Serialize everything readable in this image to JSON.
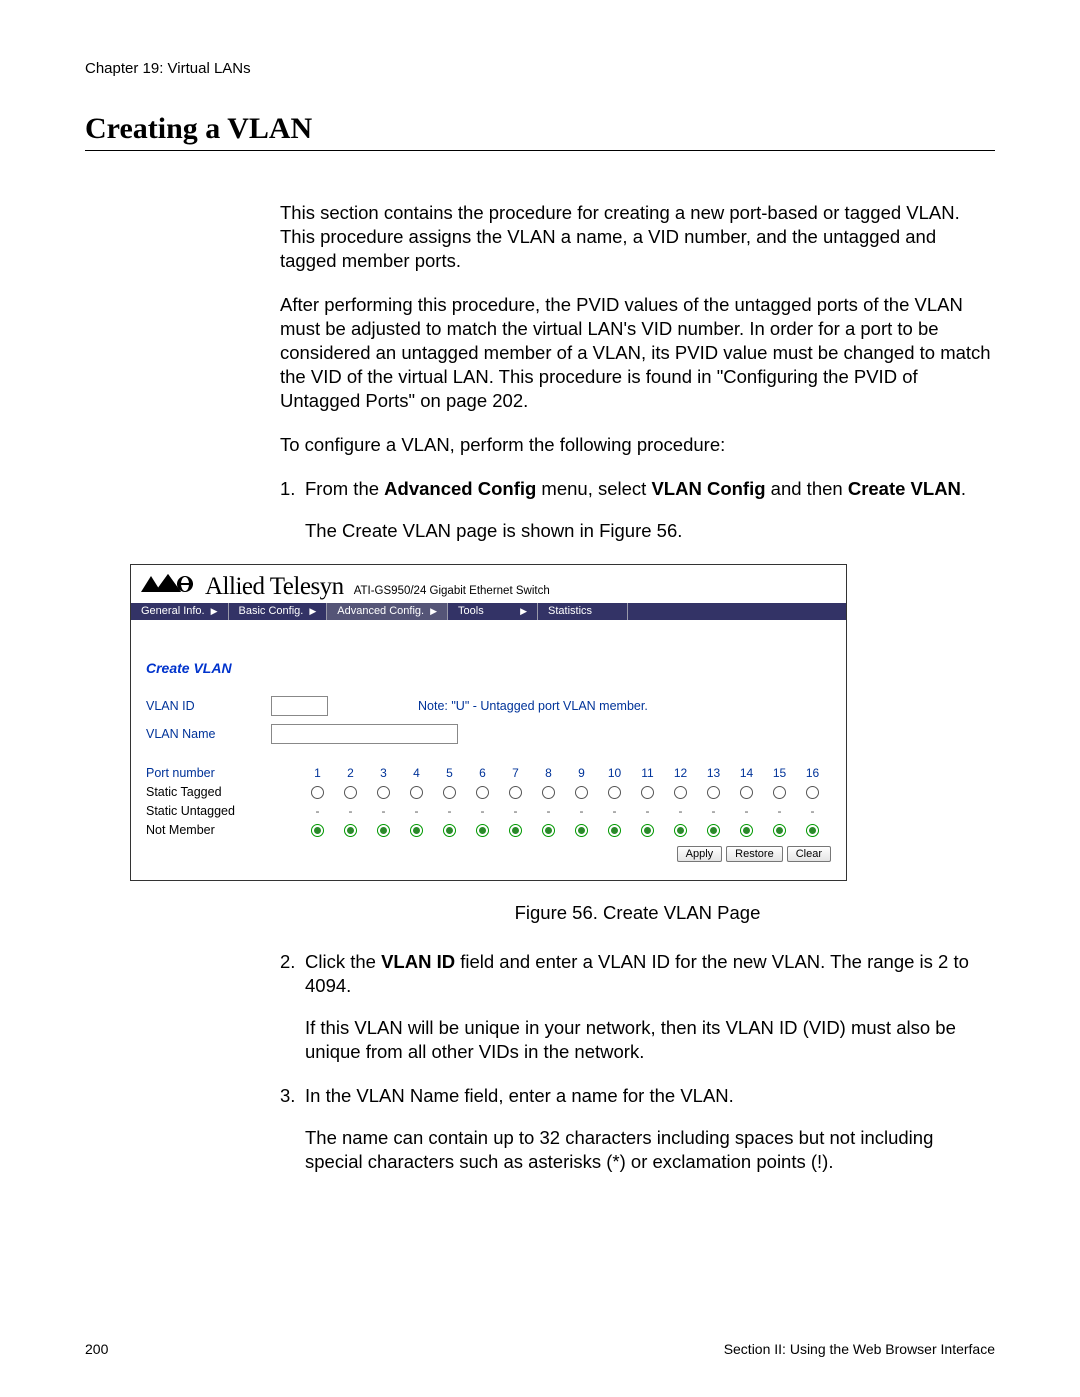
{
  "chapter": "Chapter 19: Virtual LANs",
  "title": "Creating a VLAN",
  "para1": "This section contains the procedure for creating a new port-based or tagged VLAN. This procedure assigns the VLAN a name, a VID number, and the untagged and tagged member ports.",
  "para2": "After performing this procedure, the PVID values of the untagged ports of the VLAN must be adjusted to match the virtual LAN's VID number. In order for a port to be considered an untagged member of a VLAN, its PVID value must be changed to match the VID of the virtual LAN. This procedure is found in \"Configuring the PVID of Untagged Ports\" on page 202.",
  "para3": "To configure a VLAN, perform the following procedure:",
  "step1": {
    "num": "1.",
    "pre": "From the ",
    "b1": "Advanced Config",
    "mid": " menu, select ",
    "b2": "VLAN Config",
    "mid2": " and then ",
    "b3": "Create VLAN",
    "end": "."
  },
  "step1_after": "The Create VLAN page is shown in Figure 56.",
  "figure": {
    "brand": "Allied Telesyn",
    "model": "ATI-GS950/24 Gigabit Ethernet Switch",
    "menu": {
      "items": [
        "General Info.",
        "Basic Config.",
        "Advanced Config.",
        "Tools",
        "Statistics"
      ]
    },
    "panel_title": "Create VLAN",
    "vlan_id_label": "VLAN ID",
    "vlan_name_label": "VLAN Name",
    "note": "Note: \"U\" - Untagged port VLAN member.",
    "port_number_label": "Port number",
    "static_tagged_label": "Static Tagged",
    "static_untagged_label": "Static Untagged",
    "not_member_label": "Not Member",
    "ports": [
      "1",
      "2",
      "3",
      "4",
      "5",
      "6",
      "7",
      "8",
      "9",
      "10",
      "11",
      "12",
      "13",
      "14",
      "15",
      "16"
    ],
    "buttons": {
      "apply": "Apply",
      "restore": "Restore",
      "clear": "Clear"
    }
  },
  "figure_caption": "Figure 56. Create VLAN Page",
  "step2": {
    "num": "2.",
    "pre": "Click the ",
    "b1": "VLAN ID",
    "post": " field and enter a VLAN ID for the new VLAN. The range is 2 to 4094."
  },
  "step2_after": "If this VLAN will be unique in your network, then its VLAN ID (VID) must also be unique from all other VIDs in the network.",
  "step3": {
    "num": "3.",
    "text": "In the VLAN Name field, enter a name for the VLAN."
  },
  "step3_after": "The name can contain up to 32 characters including spaces but not including special characters such as asterisks (*) or exclamation points (!).",
  "footer": {
    "page": "200",
    "section": "Section II: Using the Web Browser Interface"
  },
  "chart_data": {
    "type": "table",
    "title": "Create VLAN port membership (Figure 56)",
    "columns": [
      "Port",
      "Static Tagged",
      "Static Untagged",
      "Not Member"
    ],
    "rows": [
      [
        1,
        "unselected",
        "-",
        "selected"
      ],
      [
        2,
        "unselected",
        "-",
        "selected"
      ],
      [
        3,
        "unselected",
        "-",
        "selected"
      ],
      [
        4,
        "unselected",
        "-",
        "selected"
      ],
      [
        5,
        "unselected",
        "-",
        "selected"
      ],
      [
        6,
        "unselected",
        "-",
        "selected"
      ],
      [
        7,
        "unselected",
        "-",
        "selected"
      ],
      [
        8,
        "unselected",
        "-",
        "selected"
      ],
      [
        9,
        "unselected",
        "-",
        "selected"
      ],
      [
        10,
        "unselected",
        "-",
        "selected"
      ],
      [
        11,
        "unselected",
        "-",
        "selected"
      ],
      [
        12,
        "unselected",
        "-",
        "selected"
      ],
      [
        13,
        "unselected",
        "-",
        "selected"
      ],
      [
        14,
        "unselected",
        "-",
        "selected"
      ],
      [
        15,
        "unselected",
        "-",
        "selected"
      ],
      [
        16,
        "unselected",
        "-",
        "selected"
      ]
    ]
  }
}
